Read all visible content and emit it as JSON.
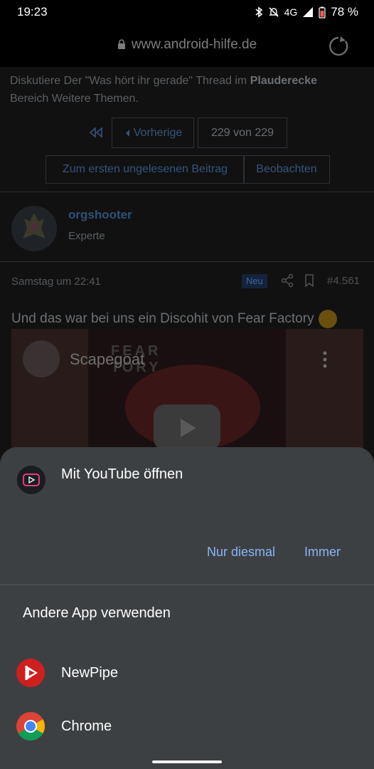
{
  "status_bar": {
    "time": "19:23",
    "network": "4G",
    "battery": "78 %"
  },
  "browser": {
    "url": "www.android-hilfe.de"
  },
  "page": {
    "thread_line1": "Diskutiere Der \"Was hört ihr gerade\" Thread im",
    "forum_name": "Plauderecke",
    "thread_line2_prefix": "Bereich Weitere Themen.",
    "pagination": {
      "prev_label": "Vorherige",
      "count": "229 von 229"
    },
    "first_unread_label": "Zum ersten ungelesenen Beitrag",
    "watch_label": "Beobachten",
    "author": {
      "name": "orgshooter",
      "title": "Experte"
    },
    "post": {
      "date": "Samstag um 22:41",
      "badge": "Neu",
      "number": "#4.561",
      "text": "Und das war bei uns ein Discohit von Fear Factory"
    },
    "video": {
      "title": "Scapegoat"
    }
  },
  "sheet": {
    "title": "Mit YouTube öffnen",
    "once_label": "Nur diesmal",
    "always_label": "Immer",
    "other_apps_title": "Andere App verwenden",
    "apps": [
      {
        "label": "NewPipe",
        "icon": "newpipe-icon"
      },
      {
        "label": "Chrome",
        "icon": "chrome-icon"
      }
    ]
  },
  "colors": {
    "sheet_bg": "#3d4043",
    "accent": "#8ab4f8",
    "newpipe": "#cd201f"
  }
}
